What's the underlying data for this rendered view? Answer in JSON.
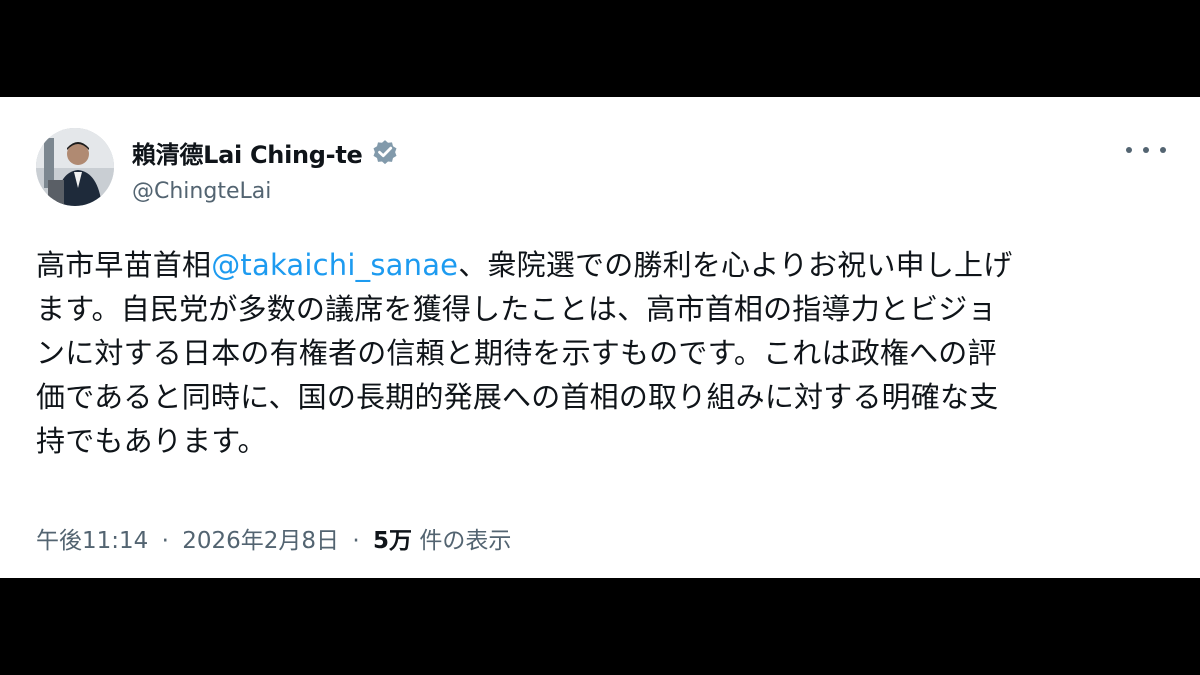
{
  "author": {
    "display_name": "賴清德Lai Ching-te",
    "handle": "@ChingteLai",
    "verified": true,
    "avatar_icon": "profile-photo"
  },
  "post": {
    "lines": [
      {
        "before": "高市早苗首相",
        "mention": "@takaichi_sanae",
        "after": "、衆院選での勝利を心よりお祝い申し上げ"
      },
      {
        "text": "ます。自民党が多数の議席を獲得したことは、高市首相の指導力とビジョ"
      },
      {
        "text": "ンに対する日本の有権者の信頼と期待を示すものです。これは政権への評"
      },
      {
        "text": "価であると同時に、国の長期的発展への首相の取り組みに対する明確な支"
      },
      {
        "text": "持でもあります。"
      }
    ]
  },
  "meta": {
    "time": "午後11:14",
    "separator": "·",
    "date": "2026年2月8日",
    "views_count": "5万",
    "views_label": "件の表示"
  },
  "icons": {
    "verified": "verified-badge-icon",
    "more": "more-options-icon"
  },
  "colors": {
    "text_primary": "#0f1419",
    "text_secondary": "#536471",
    "link": "#1d9bf0",
    "verified_badge": "#829aab",
    "background": "#ffffff",
    "letterbox": "#000000"
  }
}
